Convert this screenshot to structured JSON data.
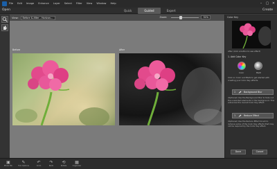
{
  "menu": {
    "items": [
      "File",
      "Edit",
      "Image",
      "Enhance",
      "Layer",
      "Select",
      "Filter",
      "View",
      "Window",
      "Help"
    ]
  },
  "window_controls": [
    "–",
    "▢",
    "✕"
  ],
  "modebar": {
    "open_label": "Open",
    "tabs": [
      {
        "label": "Quick",
        "active": false
      },
      {
        "label": "Guided",
        "active": true
      },
      {
        "label": "Expert",
        "active": false
      }
    ],
    "create_label": "Create"
  },
  "toolbox": {
    "zoom_icon": "magnifier-icon",
    "hand_icon": "hand-icon"
  },
  "options": {
    "view_label": "View:",
    "view_value": "Before & After - Horizon...",
    "zoom_label": "Zoom:",
    "zoom_value": "31%",
    "zoom_fraction": 0.3
  },
  "canvas": {
    "before_label": "Before",
    "after_label": "After"
  },
  "panel": {
    "title": "Color Key",
    "intro": "After (click a button to see effect)",
    "step1": "1. Add Color Key",
    "color_label": "Color",
    "bw_label": "B&W",
    "step1_desc": "Click on Color and B&W to get started with creating your Color Key effects.",
    "step2_num": "2.",
    "step2_label": "Background Blur",
    "step2_desc": "(Optional) Use the Background Blur to fade out the unwanted elements in the background. This enhances the overall Color Key effect.",
    "step3_num": "3.",
    "step3_label": "Reduce Effect",
    "step3_desc": "(Optional) Use the Reduce Effect brush to remove some of the Color Key effects that may not be required by the Color Key effect.",
    "done_label": "Done",
    "cancel_label": "Cancel"
  },
  "bottom": {
    "items": [
      {
        "icon": "photo-bin-icon",
        "label": "Photo Bin"
      },
      {
        "icon": "tool-options-icon",
        "label": "Tool Options"
      },
      {
        "icon": "undo-icon",
        "label": "Undo"
      },
      {
        "icon": "redo-icon",
        "label": "Redo"
      },
      {
        "icon": "rotate-icon",
        "label": "Rotate"
      },
      {
        "icon": "organizer-icon",
        "label": "Organizer"
      }
    ]
  },
  "colors": {
    "accent_tab": "#5a5a5a",
    "canvas_bg": "#7b7b7b",
    "flower_pink": "#e24a8c",
    "stem_green": "#6fae3a"
  }
}
